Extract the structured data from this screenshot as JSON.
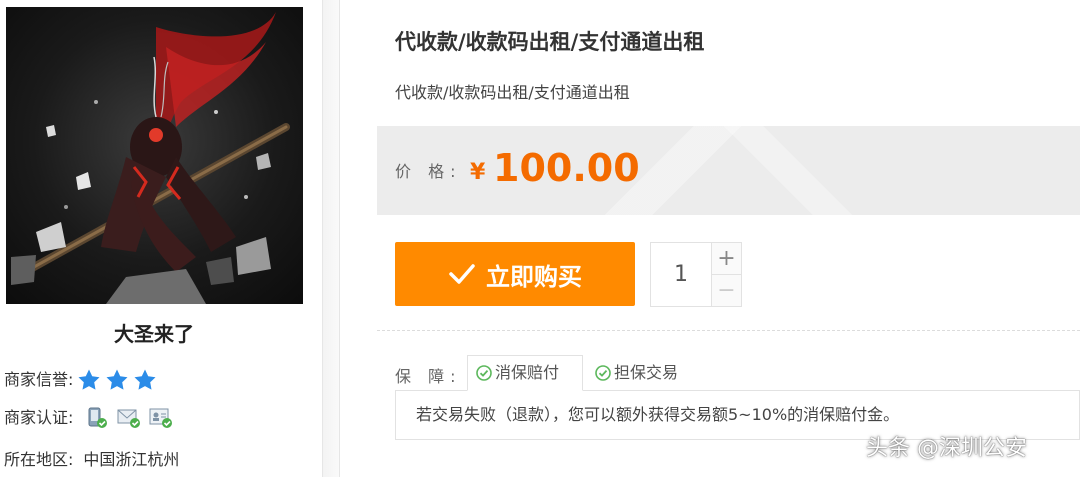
{
  "shop": {
    "name": "大圣来了",
    "credit_label": "商家信誉:",
    "credit_stars": 3,
    "cert_label": "商家认证:",
    "cert_icons": [
      "phone-verified-icon",
      "email-verified-icon",
      "id-card-verified-icon"
    ],
    "region_label": "所在地区:",
    "region_value": "中国浙江杭州"
  },
  "product": {
    "title": "代收款/收款码出租/支付通道出租",
    "subtitle": "代收款/收款码出租/支付通道出租",
    "price_label": "价 格:",
    "currency_symbol": "¥",
    "price": "100.00",
    "buy_label": "立即购买",
    "quantity": "1",
    "plus_label": "+",
    "minus_label": "−"
  },
  "guarantee": {
    "label": "保 障:",
    "tabs": [
      "消保赔付",
      "担保交易"
    ],
    "active_tab": 0,
    "content": "若交易失败（退款），您可以额外获得交易额5~10%的消保赔付金。"
  },
  "watermark": "头条 @深圳公安",
  "colors": {
    "accent": "#ff8a00",
    "price": "#f46b00",
    "star": "#2b8ce8",
    "check": "#5cb85c"
  }
}
